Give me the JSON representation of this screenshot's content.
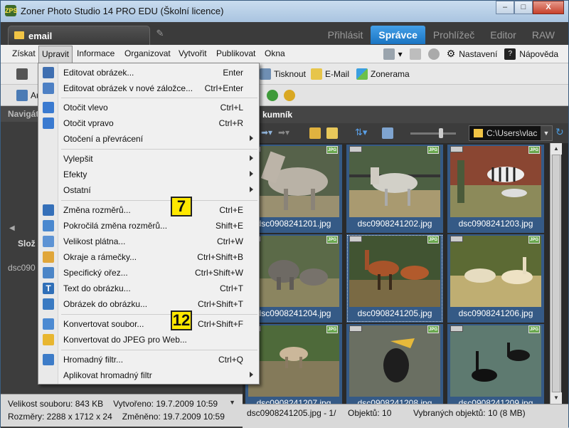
{
  "window": {
    "title": "Zoner Photo Studio 14 PRO EDU (Školní licence)",
    "app_icon": "ZPS"
  },
  "window_controls": {
    "minimize": "–",
    "maximize": "□",
    "close": "X"
  },
  "doc_tab": {
    "label": "email",
    "icon": "folder-icon"
  },
  "modes": [
    "Přihlásit",
    "Správce",
    "Prohlížeč",
    "Editor",
    "RAW"
  ],
  "active_mode": "Správce",
  "menubar": [
    "Získat",
    "Upravit",
    "Informace",
    "Organizovat",
    "Vytvořit",
    "Publikovat",
    "Okna"
  ],
  "menubar_right": {
    "settings": "Nastavení",
    "help": "Nápověda"
  },
  "toolbar1": {
    "print": "Tisknout",
    "email": "E-Mail",
    "zonerama": "Zonerama"
  },
  "toolbar2": {
    "partial_label": "Au"
  },
  "left_panel": {
    "header": "Navigát",
    "tab": "Slož",
    "file": "dsc090"
  },
  "info": {
    "size": "Velikost souboru: 843 KB",
    "created": "Vytvořeno: 19.7.2009 10:59",
    "dimensions": "Rozměry: 2288 x 1712 x 24",
    "modified": "Změněno: 19.7.2009 10:59"
  },
  "content": {
    "header": "kumník",
    "path": "C:\\Users\\vlac"
  },
  "thumbnails": [
    {
      "caption": "dsc0908241201.jpg"
    },
    {
      "caption": "dsc0908241202.jpg"
    },
    {
      "caption": "dsc0908241203.jpg"
    },
    {
      "caption": "dsc0908241204.jpg"
    },
    {
      "caption": "dsc0908241205.jpg"
    },
    {
      "caption": "dsc0908241206.jpg"
    },
    {
      "caption": "dsc0908241207.jpg"
    },
    {
      "caption": "dsc0908241208.jpg"
    },
    {
      "caption": "dsc0908241209.jpg"
    }
  ],
  "badges": {
    "jpg": "JPG"
  },
  "status": {
    "current": "dsc0908241205.jpg - 1/",
    "objects": "Objektů: 10",
    "selected": "Vybraných objektů: 10 (8 MB)"
  },
  "menu": {
    "items": [
      {
        "label": "Editovat obrázek...",
        "shortcut": "Enter",
        "icon": "edit-image-icon"
      },
      {
        "label": "Editovat obrázek v nové záložce...",
        "shortcut": "Ctrl+Enter",
        "icon": "edit-new-tab-icon"
      },
      {
        "label": "Otočit vlevo",
        "shortcut": "Ctrl+L",
        "icon": "rotate-left-icon"
      },
      {
        "label": "Otočit vpravo",
        "shortcut": "Ctrl+R",
        "icon": "rotate-right-icon"
      },
      {
        "label": "Otočení a převrácení",
        "shortcut": "",
        "submenu": true
      },
      {
        "label": "Vylepšit",
        "shortcut": "",
        "submenu": true
      },
      {
        "label": "Efekty",
        "shortcut": "",
        "submenu": true
      },
      {
        "label": "Ostatní",
        "shortcut": "",
        "submenu": true
      },
      {
        "label": "Změna rozměrů...",
        "shortcut": "Ctrl+E",
        "icon": "resize-icon"
      },
      {
        "label": "Pokročilá změna rozměrů...",
        "shortcut": "Shift+E",
        "icon": "advanced-resize-icon"
      },
      {
        "label": "Velikost plátna...",
        "shortcut": "Ctrl+W",
        "icon": "canvas-size-icon"
      },
      {
        "label": "Okraje a rámečky...",
        "shortcut": "Ctrl+Shift+B",
        "icon": "borders-icon"
      },
      {
        "label": "Specifický ořez...",
        "shortcut": "Ctrl+Shift+W",
        "icon": "crop-icon"
      },
      {
        "label": "Text do obrázku...",
        "shortcut": "Ctrl+T",
        "icon": "text-icon"
      },
      {
        "label": "Obrázek do obrázku...",
        "shortcut": "Ctrl+Shift+T",
        "icon": "image-in-image-icon"
      },
      {
        "label": "Konvertovat soubor...",
        "shortcut": "Ctrl+Shift+F",
        "icon": "convert-icon"
      },
      {
        "label": "Konvertovat do JPEG pro Web...",
        "shortcut": "",
        "icon": "convert-jpeg-icon"
      },
      {
        "label": "Hromadný filtr...",
        "shortcut": "Ctrl+Q",
        "icon": "batch-filter-icon"
      },
      {
        "label": "Aplikovat hromadný filtr",
        "shortcut": "",
        "submenu": true
      }
    ]
  },
  "callouts": [
    "7",
    "12"
  ],
  "colors": {
    "accent": "#1a74c2",
    "callout": "#ffe800",
    "selection": "#355a86"
  }
}
